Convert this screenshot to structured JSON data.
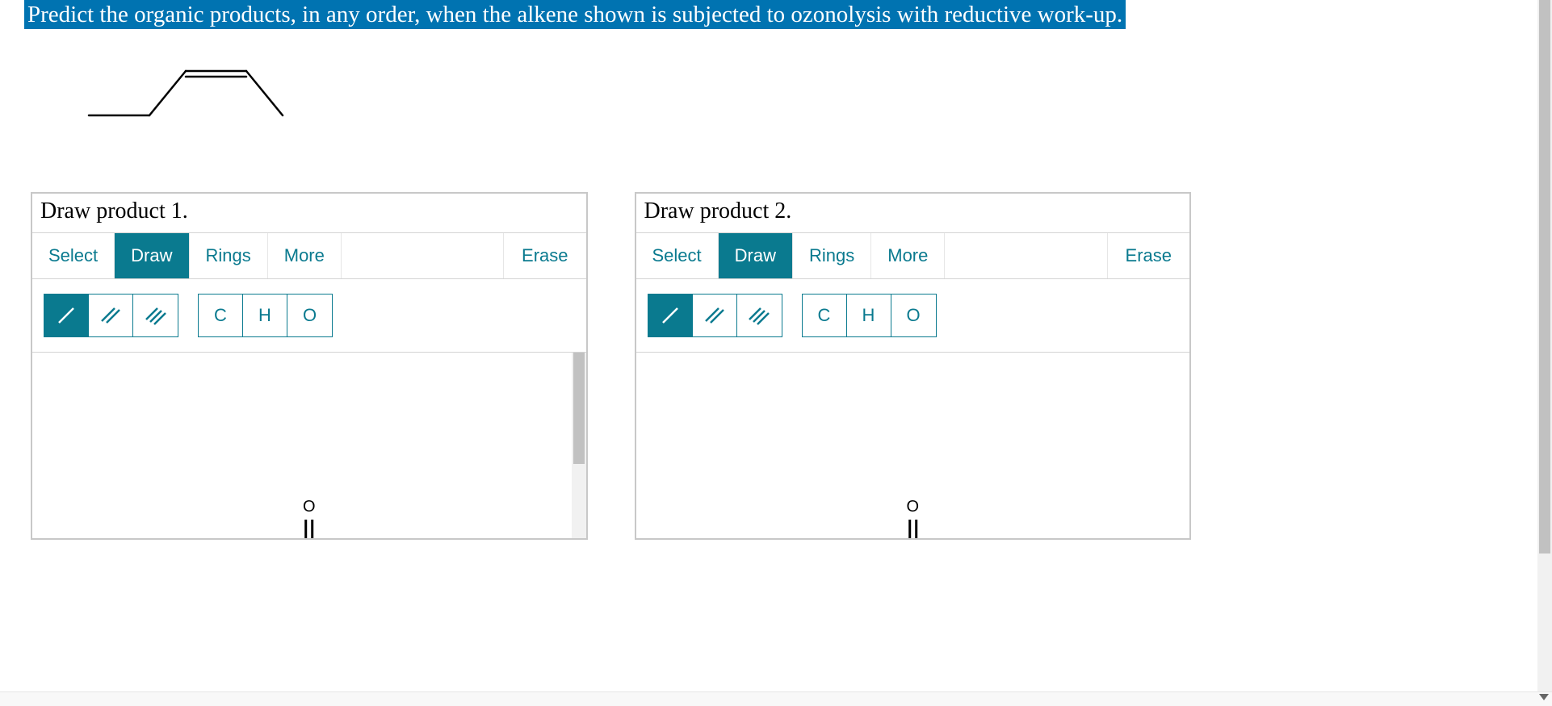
{
  "question": "Predict the organic products, in any order, when the alkene shown is subjected to ozonolysis with reductive work-up.",
  "panel1": {
    "title": "Draw product 1.",
    "tabs": {
      "select": "Select",
      "draw": "Draw",
      "rings": "Rings",
      "more": "More"
    },
    "erase": "Erase",
    "atoms": {
      "c": "C",
      "h": "H",
      "o": "O"
    },
    "canvas_atom": "O"
  },
  "panel2": {
    "title": "Draw product 2.",
    "tabs": {
      "select": "Select",
      "draw": "Draw",
      "rings": "Rings",
      "more": "More"
    },
    "erase": "Erase",
    "atoms": {
      "c": "C",
      "h": "H",
      "o": "O"
    },
    "canvas_atom": "O"
  }
}
